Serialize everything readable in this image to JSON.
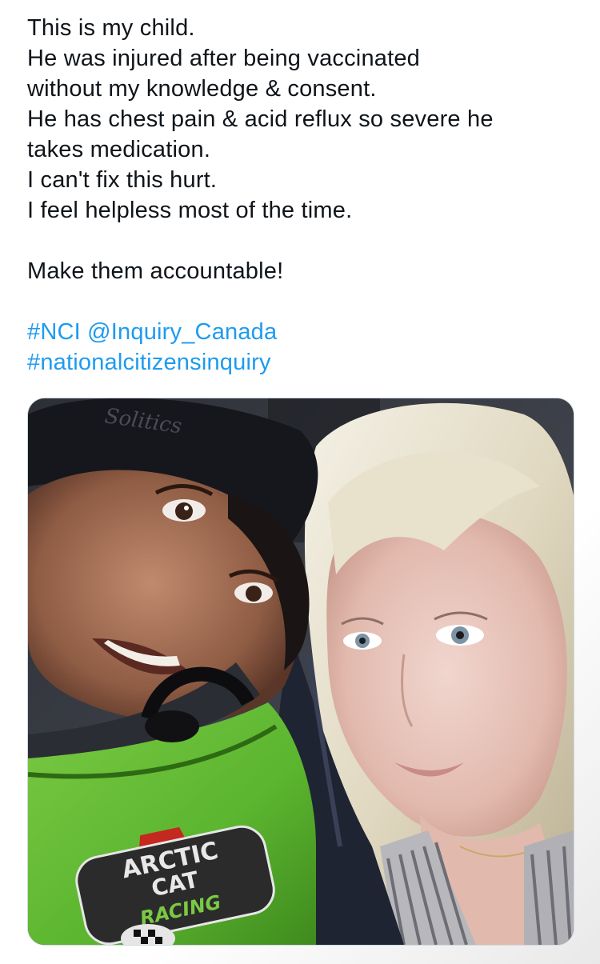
{
  "tweet": {
    "lines": [
      "This is my child.",
      "He was injured after being vaccinated",
      "without my knowledge & consent.",
      "He has chest pain & acid reflux so severe he",
      "takes medication.",
      "I can't fix this hurt.",
      "I feel helpless most of the time."
    ],
    "cta": "Make them accountable!",
    "hashtag_nci": "#NCI",
    "mention": "@Inquiry_Canada",
    "hashtag_inquiry": "#nationalcitizensinquiry"
  },
  "photo": {
    "beanie_text": "Solitics",
    "jacket_logo": [
      "ARCTIC",
      "CAT",
      "RACING"
    ]
  },
  "colors": {
    "link": "#1d9bf0",
    "text": "#0f1419",
    "jacket_green": "#5bb52f"
  }
}
